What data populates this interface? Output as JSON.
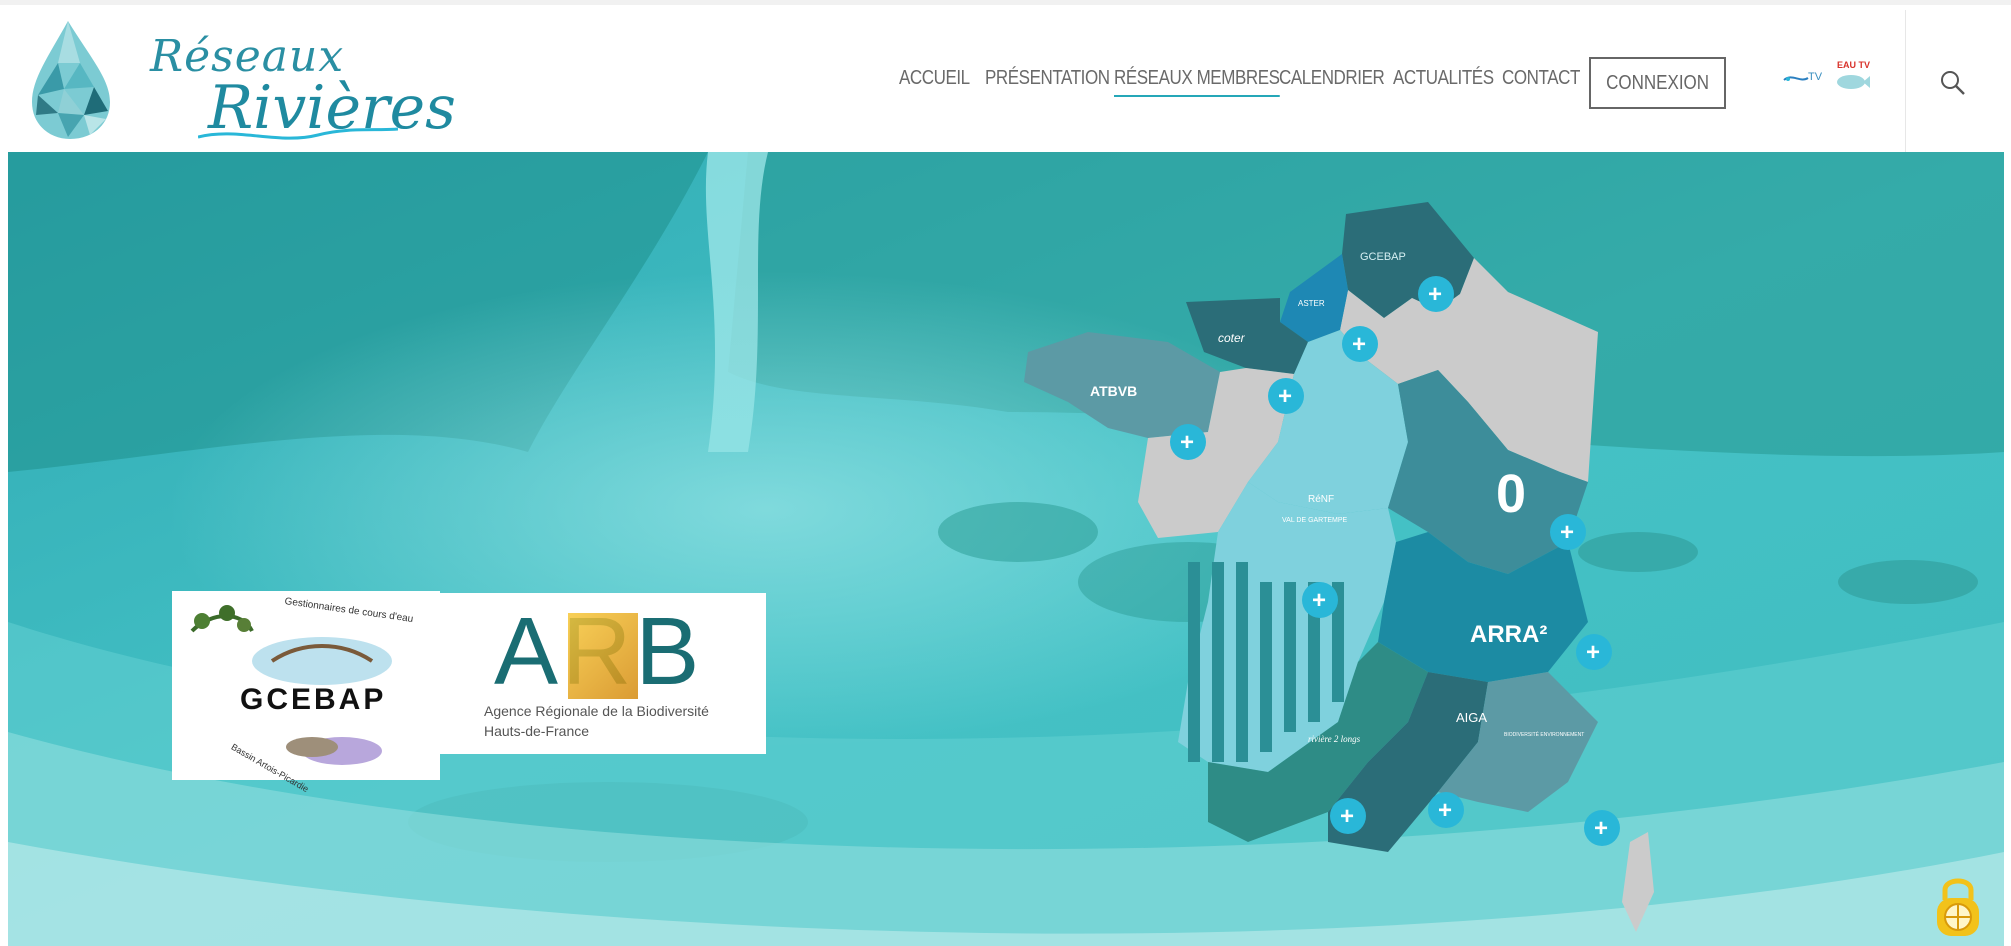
{
  "site": {
    "logo": {
      "line1": "Réseaux",
      "line2": "Rivières"
    },
    "nav": [
      {
        "label": "ACCUEIL",
        "active": false
      },
      {
        "label": "PRÉSENTATION",
        "active": false
      },
      {
        "label": "RÉSEAUX MEMBRES",
        "active": true
      },
      {
        "label": "CALENDRIER",
        "active": false
      },
      {
        "label": "ACTUALITÉS",
        "active": false
      },
      {
        "label": "CONTACT",
        "active": false
      }
    ],
    "login_label": "CONNEXION",
    "tv_labels": [
      "TV",
      "EAU TV"
    ],
    "search_icon": "search-icon"
  },
  "hero": {
    "partners": {
      "gcebap": {
        "name": "GCEBAP",
        "arc_text": "Gestionnaires de cours d'eau",
        "sub": "Bassin Artois-Picardie"
      },
      "arb": {
        "letters": "ARB",
        "line1": "Agence Régionale de la Biodiversité",
        "line2": "Hauts-de-France"
      }
    },
    "map": {
      "regions": [
        {
          "label": "GCEBAP"
        },
        {
          "label": "ASTER"
        },
        {
          "label": "coter"
        },
        {
          "label": "ATBVB"
        },
        {
          "label": "RéNF"
        },
        {
          "label": "VAL DE GARTEMPE"
        },
        {
          "label": "0"
        },
        {
          "label": "ARRA²"
        },
        {
          "label": "AIGA"
        },
        {
          "label": "BIODIVERSITÉ ENVIRONNEMENT"
        },
        {
          "label": "rivière 2 longs"
        }
      ],
      "plus_symbol": "+"
    },
    "colors": {
      "accent": "#29b7d8",
      "hero_tint": "#43c4c8",
      "dark_region": "#2b6d78",
      "light_region": "#cbcbcb"
    }
  },
  "lock_icon": "lock-icon"
}
